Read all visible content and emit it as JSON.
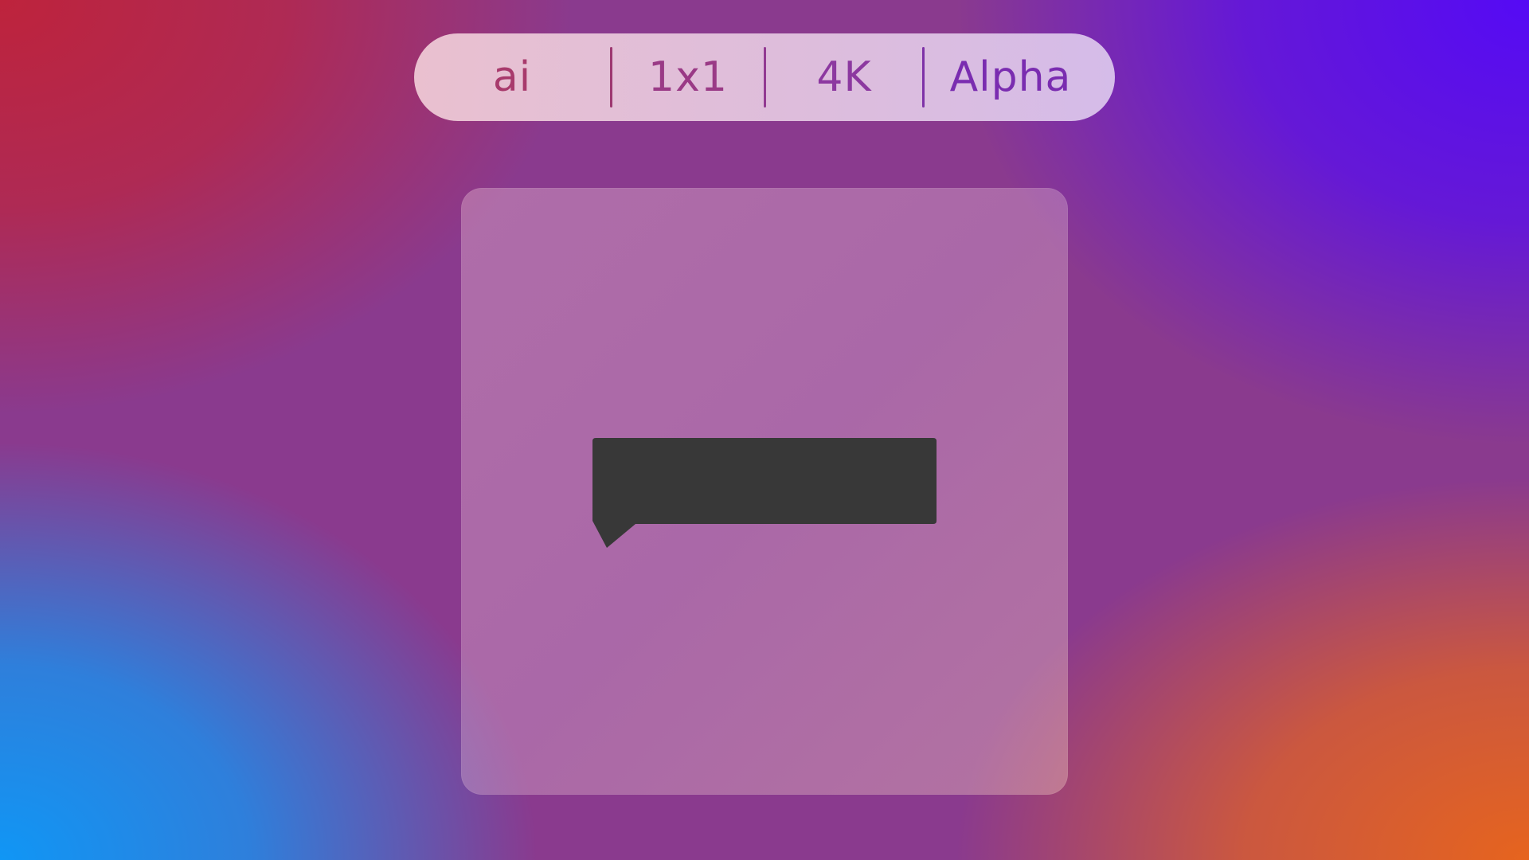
{
  "tags": {
    "source": "ai",
    "ratio": "1x1",
    "resolution": "4K",
    "channel": "Alpha"
  },
  "preview": {
    "icon": "speech-bubble-icon",
    "icon_color": "#383838"
  },
  "colors": {
    "bg_top_left": "#be233c",
    "bg_top_right": "#550af5",
    "bg_bottom_left": "#1096f5",
    "bg_bottom_right": "#e6641e",
    "pill_background": "#e8c6d8"
  }
}
